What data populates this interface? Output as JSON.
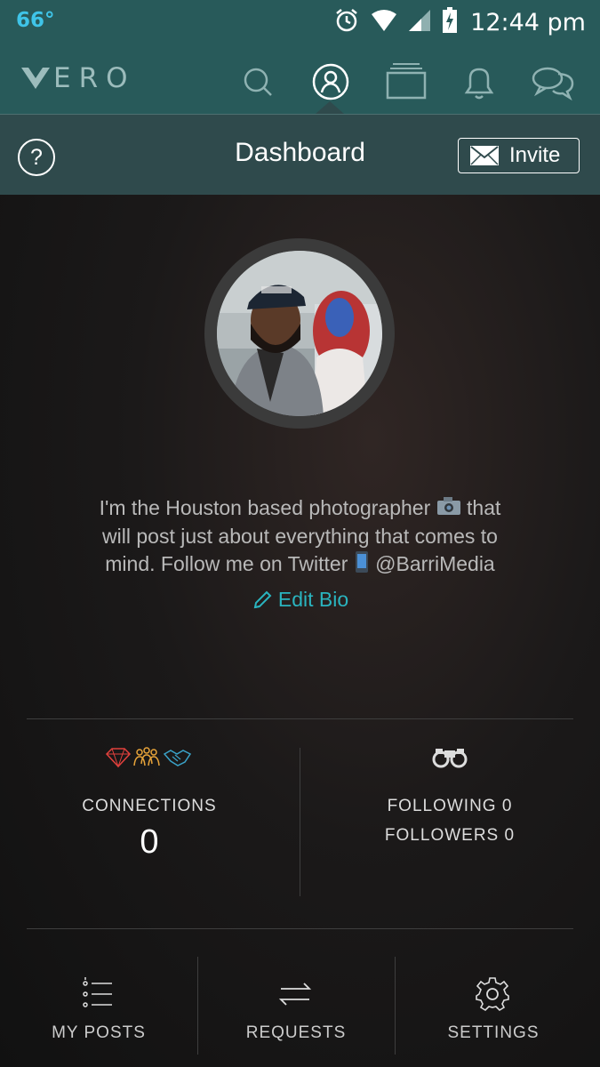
{
  "status_bar": {
    "temperature": "66°",
    "time": "12:44 pm",
    "icons": [
      "alarm-icon",
      "wifi-icon",
      "signal-icon",
      "battery-charging-icon"
    ]
  },
  "nav": {
    "logo_text": "ERO",
    "items": [
      "search-icon",
      "profile-icon",
      "stream-icon",
      "notifications-icon",
      "chat-icon"
    ],
    "active": "profile-icon"
  },
  "header": {
    "title": "Dashboard",
    "invite_label": "Invite"
  },
  "profile": {
    "bio_line1": "I'm the Houston based photographer",
    "bio_line1_end": "that",
    "bio_line2": "will post just about everything that comes to",
    "bio_line3": "mind. Follow me on Twitter",
    "bio_line3_end": "@BarriMedia",
    "edit_bio_label": "Edit Bio"
  },
  "stats": {
    "connections_label": "CONNECTIONS",
    "connections_value": "0",
    "following_label": "FOLLOWING 0",
    "followers_label": "FOLLOWERS 0"
  },
  "bottom_nav": {
    "my_posts": "MY POSTS",
    "requests": "REQUESTS",
    "settings": "SETTINGS"
  },
  "colors": {
    "bar": "#285a5a",
    "header": "#2f4a4c",
    "accent": "#2ab4bf",
    "temperature": "#3fc4e8"
  }
}
